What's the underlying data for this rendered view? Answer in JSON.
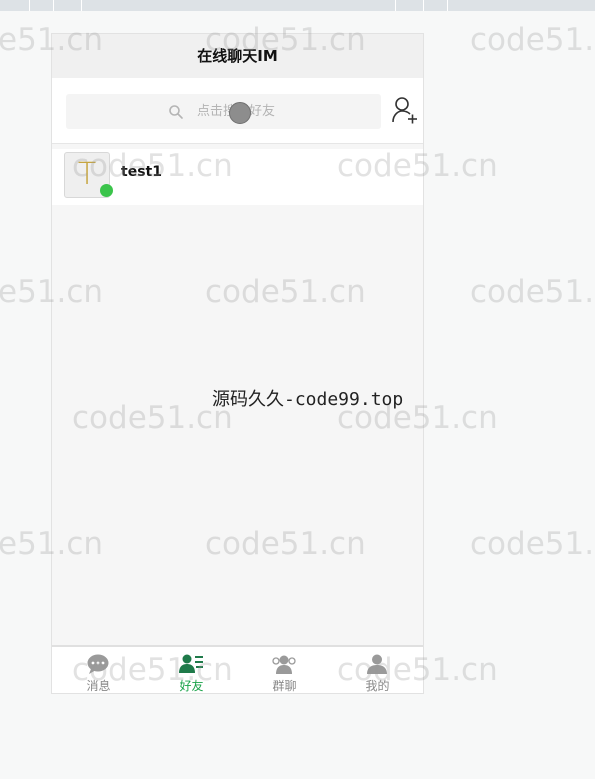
{
  "header": {
    "title": "在线聊天IM"
  },
  "search": {
    "placeholder": "点击搜索好友"
  },
  "friends": [
    {
      "avatar_letter": "T",
      "name": "test1",
      "status": "online"
    }
  ],
  "nav": [
    {
      "label": "消息",
      "icon": "chat-bubble-icon",
      "active": false
    },
    {
      "label": "好友",
      "icon": "friends-list-icon",
      "active": true
    },
    {
      "label": "群聊",
      "icon": "group-icon",
      "active": false
    },
    {
      "label": "我的",
      "icon": "user-icon",
      "active": false
    }
  ],
  "overlay": {
    "watermark": "code51.cn",
    "watermark_partial": "e51.cn",
    "source_text": "源码久久-code99.top"
  },
  "colors": {
    "accent": "#1aa34a",
    "online": "#3bc44b",
    "avatar_letter": "#c6a540"
  }
}
